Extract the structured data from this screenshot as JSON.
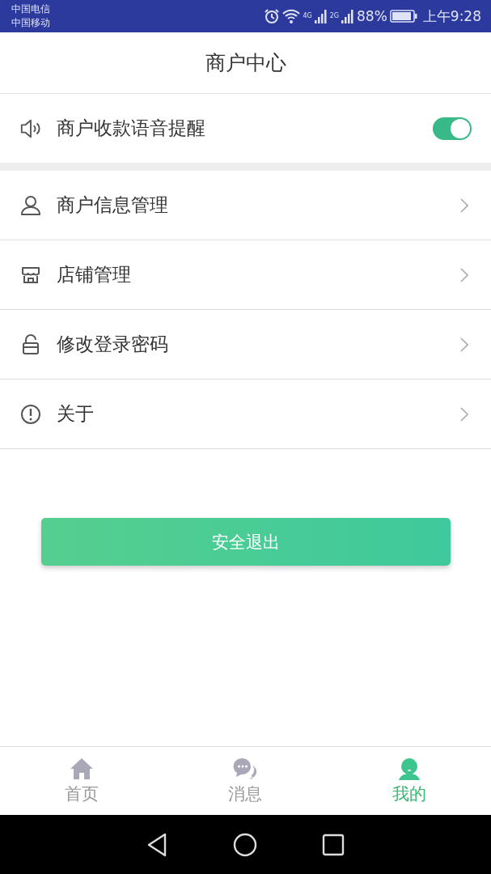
{
  "status_bar": {
    "carriers": [
      "中国电信",
      "中国移动"
    ],
    "network_1": "4G",
    "network_2": "2G",
    "battery": "88%",
    "time": "上午9:28"
  },
  "title": "商户中心",
  "voice_setting": {
    "label": "商户收款语音提醒",
    "on": true
  },
  "menu": [
    {
      "kind": "person",
      "label": "商户信息管理"
    },
    {
      "kind": "store",
      "label": "店铺管理"
    },
    {
      "kind": "lock",
      "label": "修改登录密码"
    },
    {
      "kind": "info",
      "label": "关于"
    }
  ],
  "logout_button": "安全退出",
  "tabs": [
    {
      "kind": "home",
      "label": "首页",
      "selected": false
    },
    {
      "kind": "chat",
      "label": "消息",
      "selected": false
    },
    {
      "kind": "me",
      "label": "我的",
      "selected": true
    }
  ]
}
